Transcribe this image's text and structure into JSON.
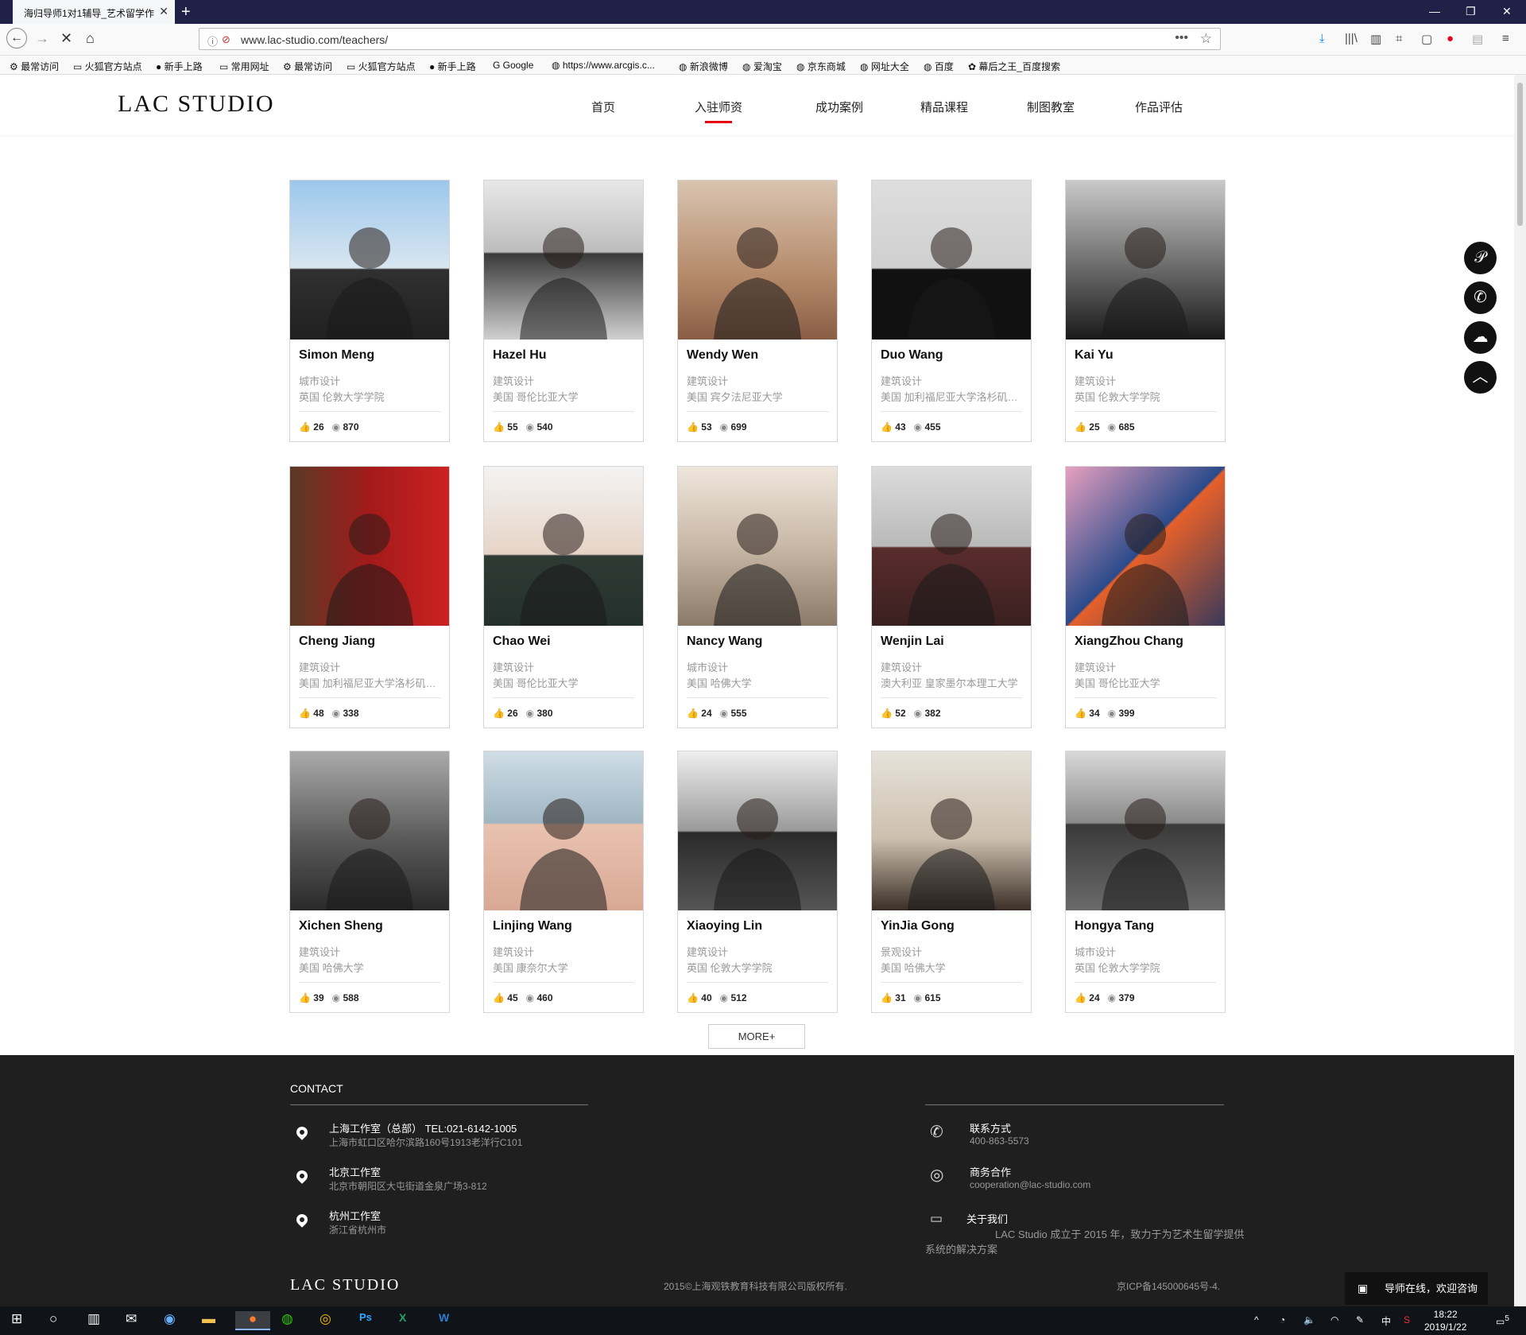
{
  "browser": {
    "tab_title": "海归导师1对1辅导_艺术留学作",
    "url": "www.lac-studio.com/teachers/",
    "bookmarks": [
      "最常访问",
      "火狐官方站点",
      "新手上路",
      "常用网址",
      "最常访问",
      "火狐官方站点",
      "新手上路",
      "Google",
      "https://www.arcgis.c...",
      "新浪微博",
      "爱淘宝",
      "京东商城",
      "网址大全",
      "百度",
      "幕后之王_百度搜索"
    ]
  },
  "site": {
    "logo": "LAC STUDIO",
    "nav": [
      "首页",
      "入驻师资",
      "成功案例",
      "精品课程",
      "制图教室",
      "作品评估"
    ],
    "active_nav": "入驻师资"
  },
  "teachers": [
    {
      "name": "Simon Meng",
      "field": "城市设计",
      "school": "英国  伦敦大学学院",
      "likes": "26",
      "views": "870"
    },
    {
      "name": "Hazel Hu",
      "field": "建筑设计",
      "school": "美国  哥伦比亚大学",
      "likes": "55",
      "views": "540"
    },
    {
      "name": "Wendy Wen",
      "field": "建筑设计",
      "school": "美国  宾夕法尼亚大学",
      "likes": "53",
      "views": "699"
    },
    {
      "name": "Duo Wang",
      "field": "建筑设计",
      "school": "美国  加利福尼亚大学洛杉矶分校",
      "likes": "43",
      "views": "455"
    },
    {
      "name": "Kai Yu",
      "field": "建筑设计",
      "school": "英国  伦敦大学学院",
      "likes": "25",
      "views": "685"
    },
    {
      "name": "Cheng Jiang",
      "field": "建筑设计",
      "school": "美国  加利福尼亚大学洛杉矶分校",
      "likes": "48",
      "views": "338"
    },
    {
      "name": "Chao Wei",
      "field": "建筑设计",
      "school": "美国  哥伦比亚大学",
      "likes": "26",
      "views": "380"
    },
    {
      "name": "Nancy Wang",
      "field": "城市设计",
      "school": "美国  哈佛大学",
      "likes": "24",
      "views": "555"
    },
    {
      "name": "Wenjin Lai",
      "field": "建筑设计",
      "school": "澳大利亚  皇家墨尔本理工大学",
      "likes": "52",
      "views": "382"
    },
    {
      "name": "XiangZhou Chang",
      "field": "建筑设计",
      "school": "美国  哥伦比亚大学",
      "likes": "34",
      "views": "399"
    },
    {
      "name": "Xichen Sheng",
      "field": "建筑设计",
      "school": "美国  哈佛大学",
      "likes": "39",
      "views": "588"
    },
    {
      "name": "Linjing Wang",
      "field": "建筑设计",
      "school": "美国  康奈尔大学",
      "likes": "45",
      "views": "460"
    },
    {
      "name": "Xiaoying Lin",
      "field": "建筑设计",
      "school": "英国  伦敦大学学院",
      "likes": "40",
      "views": "512"
    },
    {
      "name": "YinJia Gong",
      "field": "景观设计",
      "school": "美国  哈佛大学",
      "likes": "31",
      "views": "615"
    },
    {
      "name": "Hongya Tang",
      "field": "城市设计",
      "school": "英国  伦敦大学学院",
      "likes": "24",
      "views": "379"
    }
  ],
  "more_label": "MORE+",
  "footer": {
    "contact_title": "CONTACT",
    "offices": [
      {
        "title": "上海工作室（总部）   TEL:021-6142-1005",
        "address": "上海市虹口区哈尔滨路160号1913老洋行C101"
      },
      {
        "title": "北京工作室",
        "address": "北京市朝阳区大屯街道金泉广场3-812"
      },
      {
        "title": "杭州工作室",
        "address": "浙江省杭州市"
      }
    ],
    "contact_label": "联系方式",
    "phone": "400-863-5573",
    "biz_label": "商务合作",
    "email": "cooperation@lac-studio.com",
    "about_label": "关于我们",
    "about_line1": "LAC Studio 成立于 2015 年，致力于为艺术生留学提供",
    "about_line2": "系统的解决方案",
    "logo": "LAC STUDIO",
    "copyright": "2015©上海观铁教育科技有限公司版权所有.",
    "icp": "京ICP备145000645号-4."
  },
  "chat_label": "导师在线，欢迎咨询",
  "taskbar": {
    "time": "18:22",
    "date": "2019/1/22",
    "ime": "中",
    "notif": "5"
  }
}
